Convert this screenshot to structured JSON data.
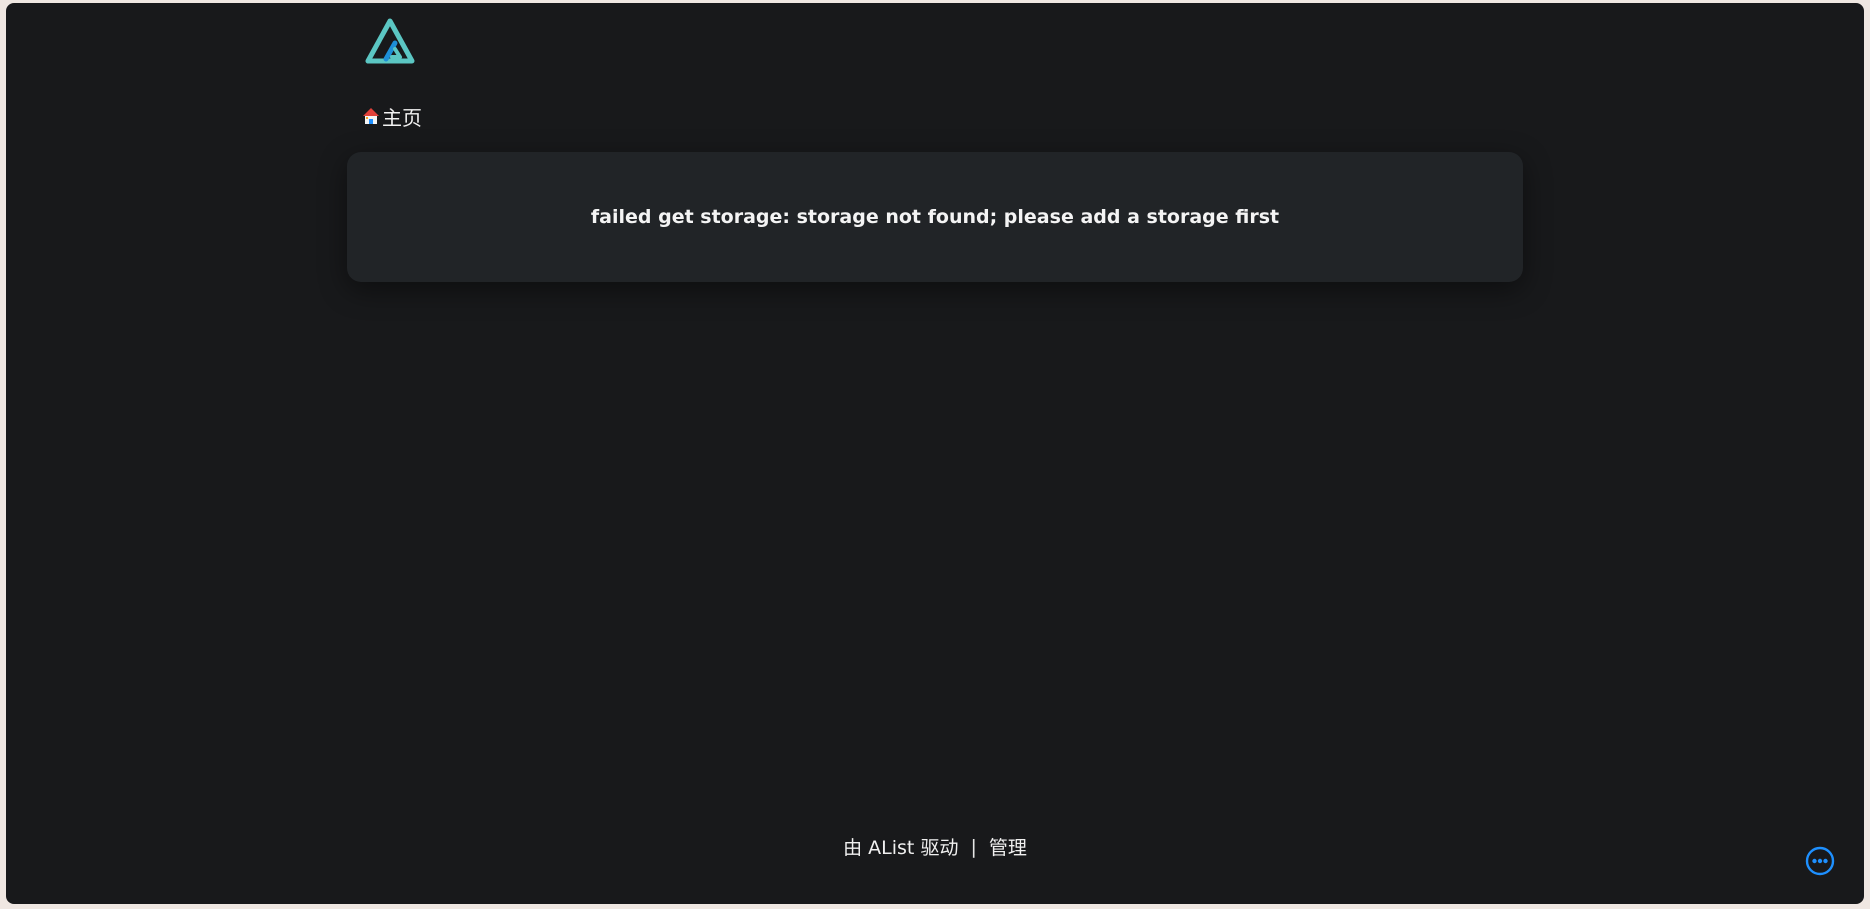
{
  "breadcrumb": {
    "home_label": "主页"
  },
  "error": {
    "message": "failed get storage: storage not found; please add a storage first"
  },
  "footer": {
    "powered_prefix": "由",
    "powered_name": "AList",
    "powered_suffix": "驱动",
    "separator": "|",
    "manage_label": "管理"
  },
  "colors": {
    "background": "#18191b",
    "card": "#212427",
    "logo_teal": "#5bc6c3",
    "logo_blue": "#1d8fd6",
    "accent_blue": "#1e90ff"
  },
  "icons": {
    "logo": "alist-logo-icon",
    "home": "home-icon",
    "more": "more-icon"
  }
}
